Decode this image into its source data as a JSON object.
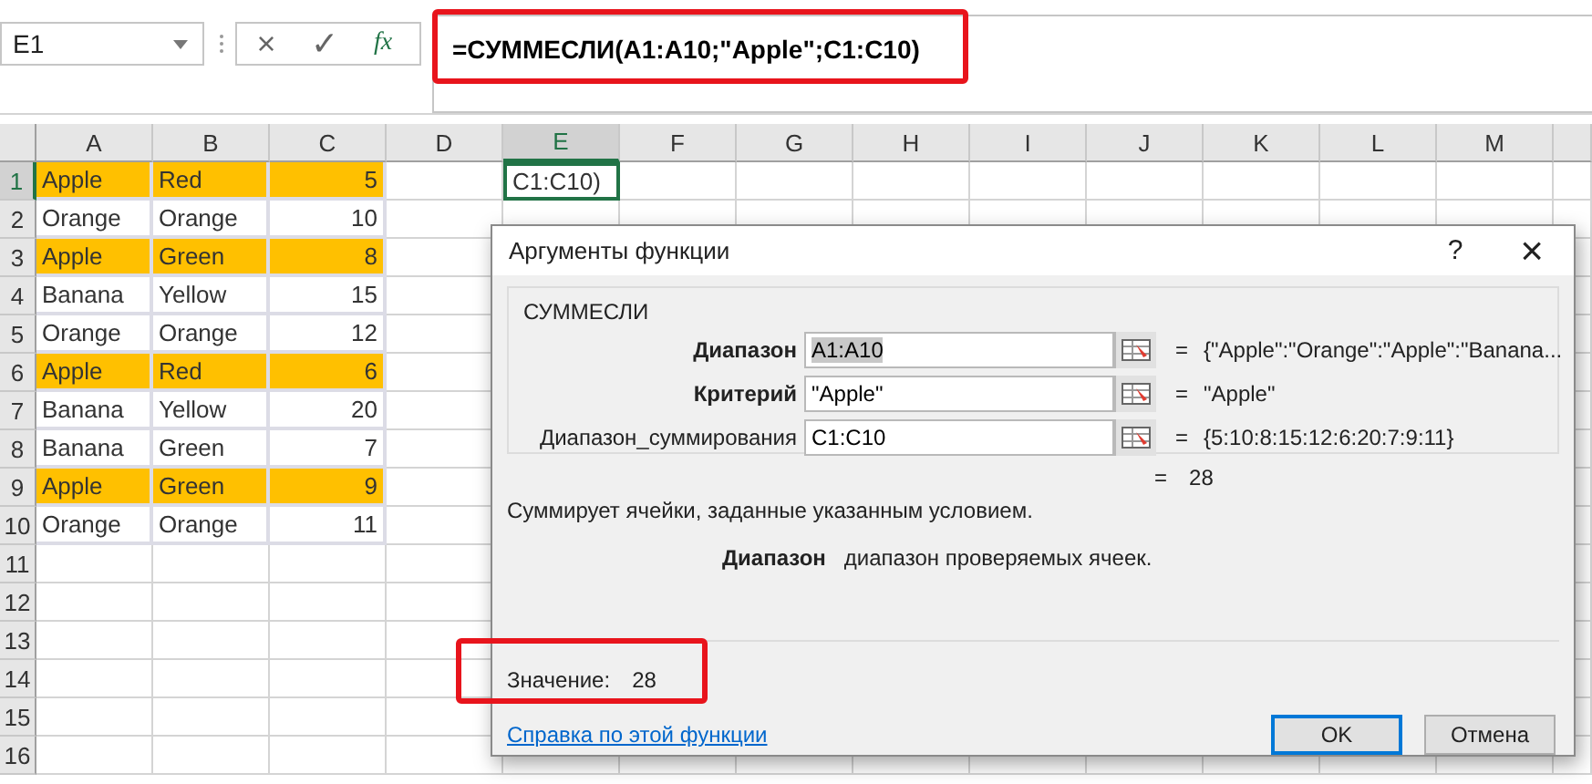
{
  "formula_bar": {
    "name_box": "E1",
    "cancel": "×",
    "enter": "✓",
    "fx": "fx",
    "formula": "=СУММЕСЛИ(A1:A10;\"Apple\";C1:C10)"
  },
  "sheet": {
    "columns": [
      {
        "label": "A",
        "selected": false
      },
      {
        "label": "B",
        "selected": false
      },
      {
        "label": "C",
        "selected": false
      },
      {
        "label": "D",
        "selected": false
      },
      {
        "label": "E",
        "selected": true
      },
      {
        "label": "F",
        "selected": false
      },
      {
        "label": "G",
        "selected": false
      },
      {
        "label": "H",
        "selected": false
      },
      {
        "label": "I",
        "selected": false
      },
      {
        "label": "J",
        "selected": false
      },
      {
        "label": "K",
        "selected": false
      },
      {
        "label": "L",
        "selected": false
      },
      {
        "label": "M",
        "selected": false
      }
    ],
    "row_numbers": [
      {
        "label": "1",
        "selected": true
      },
      {
        "label": "2",
        "selected": false
      },
      {
        "label": "3",
        "selected": false
      },
      {
        "label": "4",
        "selected": false
      },
      {
        "label": "5",
        "selected": false
      },
      {
        "label": "6",
        "selected": false
      },
      {
        "label": "7",
        "selected": false
      },
      {
        "label": "8",
        "selected": false
      },
      {
        "label": "9",
        "selected": false
      },
      {
        "label": "10",
        "selected": false
      },
      {
        "label": "11",
        "selected": false
      },
      {
        "label": "12",
        "selected": false
      },
      {
        "label": "13",
        "selected": false
      },
      {
        "label": "14",
        "selected": false
      },
      {
        "label": "15",
        "selected": false
      },
      {
        "label": "16",
        "selected": false
      }
    ],
    "rows": [
      {
        "a": "Apple",
        "b": "Red",
        "c": "5",
        "highlighted": true
      },
      {
        "a": "Orange",
        "b": "Orange",
        "c": "10",
        "highlighted": false
      },
      {
        "a": "Apple",
        "b": "Green",
        "c": "8",
        "highlighted": true
      },
      {
        "a": "Banana",
        "b": "Yellow",
        "c": "15",
        "highlighted": false
      },
      {
        "a": "Orange",
        "b": "Orange",
        "c": "12",
        "highlighted": false
      },
      {
        "a": "Apple",
        "b": "Red",
        "c": "6",
        "highlighted": true
      },
      {
        "a": "Banana",
        "b": "Yellow",
        "c": "20",
        "highlighted": false
      },
      {
        "a": "Banana",
        "b": "Green",
        "c": "7",
        "highlighted": false
      },
      {
        "a": "Apple",
        "b": "Green",
        "c": "9",
        "highlighted": true
      },
      {
        "a": "Orange",
        "b": "Orange",
        "c": "11",
        "highlighted": false
      }
    ],
    "active_cell_text": "C1:C10)"
  },
  "dialog": {
    "title": "Аргументы функции",
    "help": "?",
    "close": "×",
    "group": "СУММЕСЛИ",
    "arguments": [
      {
        "label": "Диапазон",
        "required": true,
        "value": "A1:A10",
        "selected": true,
        "equals": "=",
        "result": "{\"Apple\":\"Orange\":\"Apple\":\"Banana..."
      },
      {
        "label": "Критерий",
        "required": true,
        "value": "\"Apple\"",
        "selected": false,
        "equals": "=",
        "result": "\"Apple\""
      },
      {
        "label": "Диапазон_суммирования",
        "required": false,
        "value": "C1:C10",
        "selected": false,
        "equals": "=",
        "result": "{5:10:8:15:12:6:20:7:9:11}"
      }
    ],
    "formula_equals": "=",
    "formula_result": "28",
    "description": "Суммирует ячейки, заданные указанным условием.",
    "argument_name": "Диапазон",
    "argument_help": "диапазон проверяемых ячеек.",
    "value_label": "Значение:",
    "value": "28",
    "help_link": "Справка по этой функции",
    "buttons": [
      {
        "label": "OK",
        "default": true
      },
      {
        "label": "Отмена",
        "default": false
      }
    ]
  }
}
